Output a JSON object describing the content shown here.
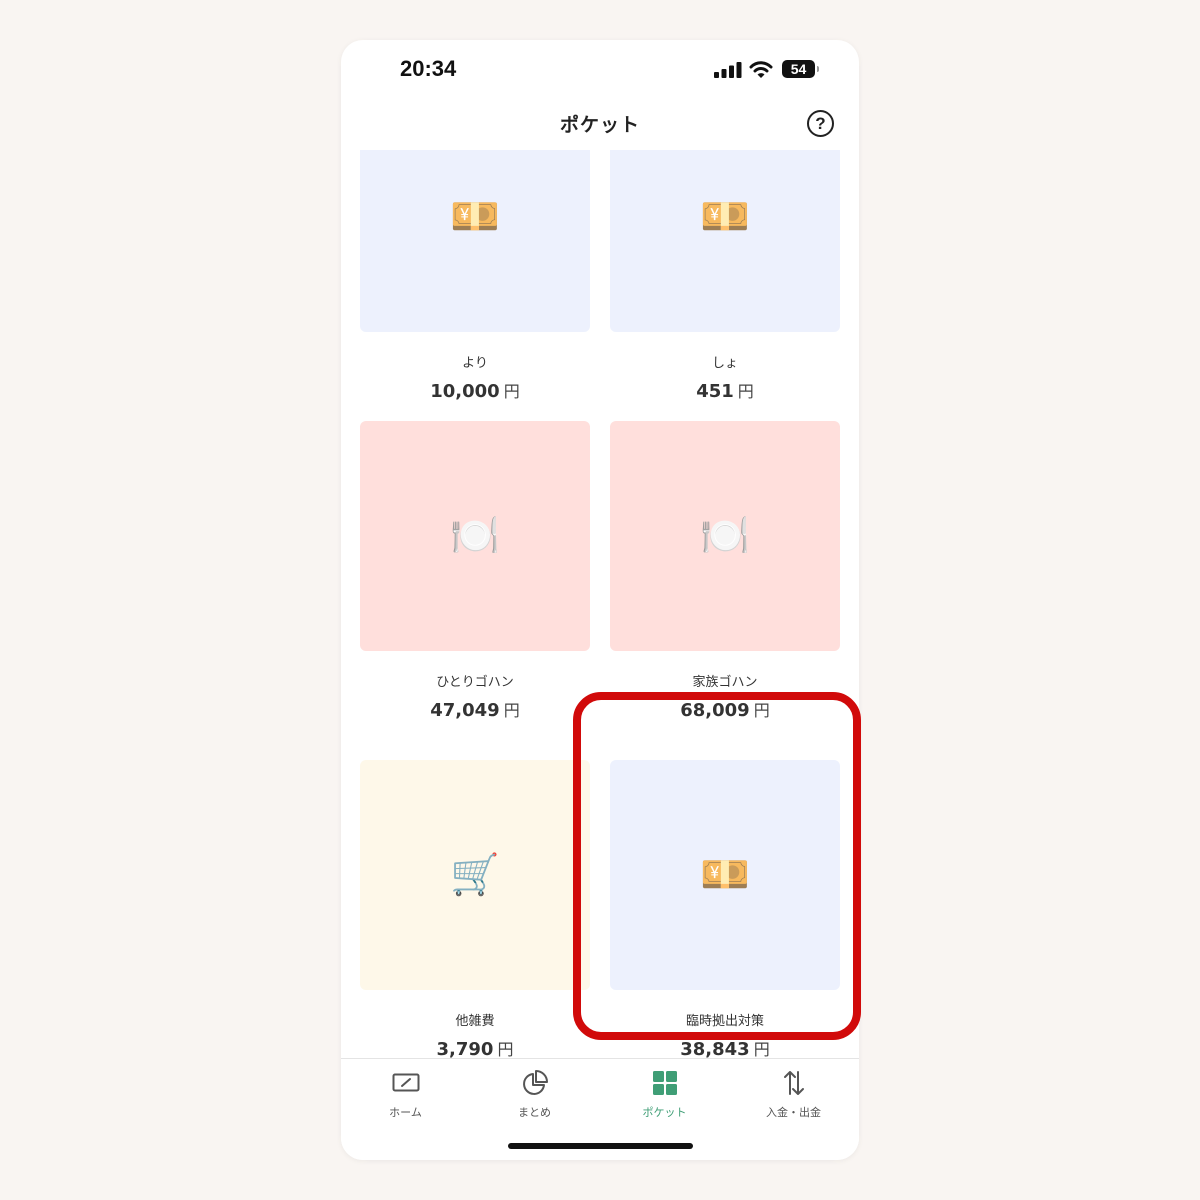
{
  "status_bar": {
    "time": "20:34",
    "battery": "54"
  },
  "header": {
    "title": "ポケット",
    "help_label": "?"
  },
  "pockets": [
    {
      "emoji": "💴",
      "name": "より",
      "amount": "10,000",
      "currency": "円",
      "tile_color": "#edf1fd"
    },
    {
      "emoji": "💴",
      "name": "しょ",
      "amount": "451",
      "currency": "円",
      "tile_color": "#edf1fd"
    },
    {
      "emoji": "🍽️",
      "name": "ひとりゴハン",
      "amount": "47,049",
      "currency": "円",
      "tile_color": "#ffdfdc"
    },
    {
      "emoji": "🍽️",
      "name": "家族ゴハン",
      "amount": "68,009",
      "currency": "円",
      "tile_color": "#ffdfdc"
    },
    {
      "emoji": "🛒",
      "name": "他雑費",
      "amount": "3,790",
      "currency": "円",
      "tile_color": "#fef8e9"
    },
    {
      "emoji": "💴",
      "name": "臨時拠出対策",
      "amount": "38,843",
      "currency": "円",
      "tile_color": "#edf1fd"
    }
  ],
  "tab_bar": {
    "items": [
      {
        "label": "ホーム",
        "icon": "home-icon"
      },
      {
        "label": "まとめ",
        "icon": "pie-chart-icon"
      },
      {
        "label": "ポケット",
        "icon": "grid-icon",
        "active": true
      },
      {
        "label": "入金・出金",
        "icon": "transfer-arrows-icon"
      }
    ]
  },
  "colors": {
    "accent": "#3f9e76",
    "highlight": "#d10a0a"
  }
}
